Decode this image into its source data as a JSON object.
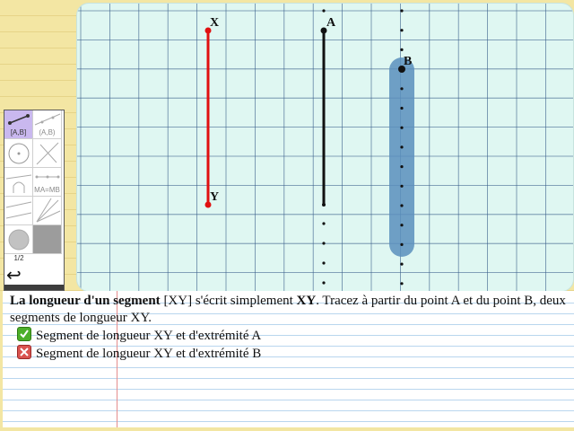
{
  "canvas": {
    "points": {
      "X": "X",
      "Y": "Y",
      "A": "A",
      "B": "B"
    },
    "colors": {
      "segment_xy": "#e01010",
      "segment_a": "#111111",
      "highlight_b": "#5b8fbd",
      "grid_line": "#3a5f8a",
      "grid_bg": "#dff7f2"
    }
  },
  "palette": {
    "tools": [
      {
        "label": "[A,B]",
        "icon": "segment-icon",
        "active": true
      },
      {
        "label": "(A,B)",
        "icon": "line-icon",
        "active": false
      },
      {
        "label": "",
        "icon": "circle-icon",
        "active": false
      },
      {
        "label": "",
        "icon": "perpendicular-icon",
        "active": false
      },
      {
        "label": "",
        "icon": "intersection-icon",
        "active": false
      },
      {
        "label": "MA=MB",
        "icon": "midpoint-icon",
        "active": false
      },
      {
        "label": "",
        "icon": "parallel-icon",
        "active": false
      },
      {
        "label": "",
        "icon": "angle-icon",
        "active": false
      },
      {
        "label": "",
        "icon": "compass-icon",
        "active": false
      },
      {
        "label": "",
        "icon": "fill-icon",
        "active": false
      }
    ],
    "page": "1/2",
    "undo": "↩"
  },
  "instructions": {
    "bold_term": "La longueur d'un segment",
    "text_1": " [XY] s'écrit simplement ",
    "bold_xy": "XY",
    "text_2": ". Tracez à partir du point A et du point B, deux segments de longueur XY."
  },
  "tasks": [
    {
      "label": "Segment de longueur XY et d'extrémité A",
      "status": "done",
      "icon": "check-icon"
    },
    {
      "label": "Segment de longueur XY et d'extrémité B",
      "status": "failed",
      "icon": "cross-icon"
    }
  ]
}
